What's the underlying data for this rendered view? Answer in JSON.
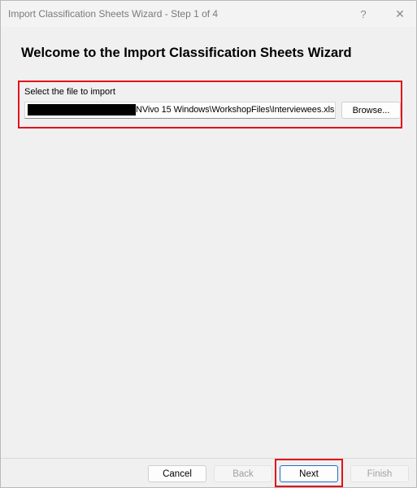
{
  "window": {
    "title": "Import Classification Sheets Wizard - Step 1 of 4",
    "help_glyph": "?",
    "close_glyph": "✕"
  },
  "main": {
    "headline": "Welcome to the Import Classification Sheets Wizard",
    "file_select": {
      "label": "Select the file to import",
      "value_visible": "NVivo 15 Windows\\WorkshopFiles\\Interviewees.xls",
      "browse_label": "Browse..."
    }
  },
  "footer": {
    "cancel_label": "Cancel",
    "back_label": "Back",
    "next_label": "Next",
    "finish_label": "Finish"
  },
  "colors": {
    "highlight": "#e3101a",
    "focus_border": "#1f6fc9",
    "disabled_text": "#a0a0a0"
  }
}
